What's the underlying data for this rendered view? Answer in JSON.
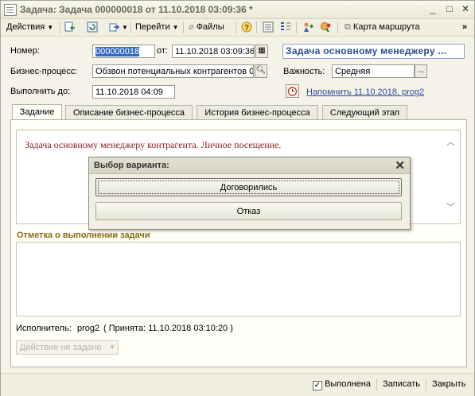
{
  "window": {
    "title": "Задача: Задача 000000018 от 11.10.2018 03:09:36 *",
    "controls": {
      "minimize": "_",
      "maximize": "□",
      "close": "✕"
    }
  },
  "toolbar": {
    "actions_label": "Действия",
    "goto_label": "Перейти",
    "files_label": "Файлы",
    "help_label": "?",
    "route_map_label": "Карта маршрута",
    "overflow": "»"
  },
  "form": {
    "number_label": "Номер:",
    "number_value": "000000018",
    "from_label": "от:",
    "date_value": "11.10.2018 03:09:36",
    "task_title": "Задача основному менеджеру ...",
    "process_label": "Бизнес-процесс:",
    "process_value": "Обзвон потенциальных контрагентов 0",
    "importance_label": "Важность:",
    "importance_value": "Средняя",
    "due_label": "Выполнить до:",
    "due_value": "11.10.2018  04:09",
    "reminder_link": "Напомнить 11.10.2018, prog2"
  },
  "tabs": [
    {
      "label": "Задание",
      "active": true
    },
    {
      "label": "Описание бизнес-процесса",
      "active": false
    },
    {
      "label": "История бизнес-процесса",
      "active": false
    },
    {
      "label": "Следующий этап",
      "active": false
    }
  ],
  "task": {
    "text": "Задача основному менеджеру контрагента. Личное посещение."
  },
  "completion": {
    "section_title": "Отметка о выполнении задачи",
    "executor_label": "Исполнитель:",
    "executor_value": "prog2",
    "accepted_text": "( Принята: 11.10.2018 03:10:20 )",
    "action_combo": "Действие не задано"
  },
  "dialog": {
    "title": "Выбор варианта:",
    "close": "✕",
    "options": [
      "Договорились",
      "Отказ"
    ]
  },
  "bottom": {
    "completed_label": "Выполнена",
    "save_label": "Записать",
    "close_label": "Закрыть"
  },
  "colors": {
    "window_bg": "#f5f3e8",
    "task_text": "#8b1d1d",
    "section_title": "#8a6d14",
    "link": "#2a4ea0",
    "selection": "#316ac5"
  }
}
